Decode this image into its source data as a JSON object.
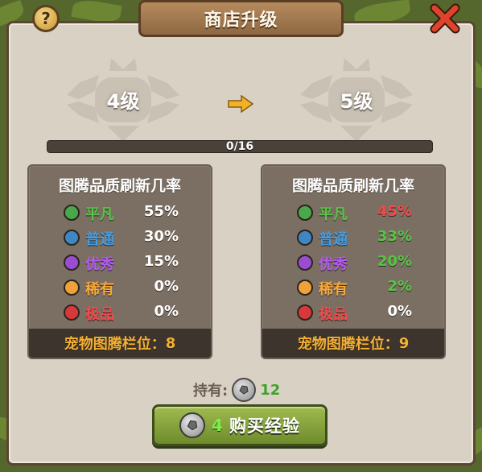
{
  "title": "商店升级",
  "help_icon": "question-mark-icon",
  "close_icon": "close-x-icon",
  "current_level": "4级",
  "next_level": "5级",
  "progress": {
    "text": "0/16",
    "current": 0,
    "max": 16
  },
  "current_card": {
    "title": "图腾品质刷新几率",
    "rows": [
      {
        "name": "平凡",
        "value": "55%",
        "dot_color": "#4aa84a",
        "name_color": "#58c447",
        "value_color": "#ffffff"
      },
      {
        "name": "普通",
        "value": "30%",
        "dot_color": "#3f86c4",
        "name_color": "#4a9bdc",
        "value_color": "#ffffff"
      },
      {
        "name": "优秀",
        "value": "15%",
        "dot_color": "#9a4dd2",
        "name_color": "#b35cf0",
        "value_color": "#ffffff"
      },
      {
        "name": "稀有",
        "value": "0%",
        "dot_color": "#f0a23a",
        "name_color": "#f6a93c",
        "value_color": "#ffffff"
      },
      {
        "name": "极品",
        "value": "0%",
        "dot_color": "#d8383a",
        "name_color": "#f04b4b",
        "value_color": "#ffffff"
      }
    ],
    "footer_label": "宠物图腾栏位：",
    "footer_value": "8"
  },
  "next_card": {
    "title": "图腾品质刷新几率",
    "rows": [
      {
        "name": "平凡",
        "value": "45%",
        "dot_color": "#4aa84a",
        "name_color": "#58c447",
        "value_color": "#f04b4b"
      },
      {
        "name": "普通",
        "value": "33%",
        "dot_color": "#3f86c4",
        "name_color": "#4a9bdc",
        "value_color": "#58c447"
      },
      {
        "name": "优秀",
        "value": "20%",
        "dot_color": "#9a4dd2",
        "name_color": "#b35cf0",
        "value_color": "#58c447"
      },
      {
        "name": "稀有",
        "value": "2%",
        "dot_color": "#f0a23a",
        "name_color": "#f6a93c",
        "value_color": "#58c447"
      },
      {
        "name": "极品",
        "value": "0%",
        "dot_color": "#d8383a",
        "name_color": "#f04b4b",
        "value_color": "#ffffff"
      }
    ],
    "footer_label": "宠物图腾栏位：",
    "footer_value": "9"
  },
  "holdings": {
    "label": "持有:",
    "value": "12",
    "icon": "stone-coin-icon"
  },
  "buy_button": {
    "cost": "4",
    "label": "购买经验",
    "icon": "stone-coin-icon"
  }
}
